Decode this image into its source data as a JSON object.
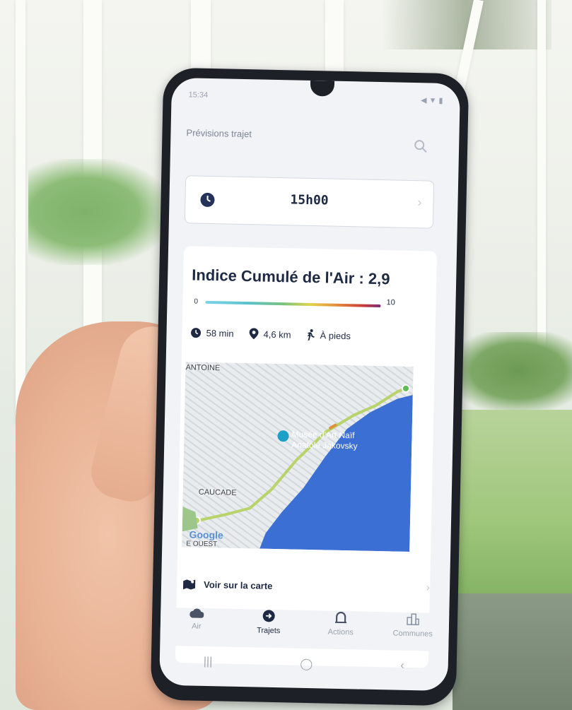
{
  "status_bar": {
    "time": "15:34",
    "right": "◀ ▼ ▮"
  },
  "header": {
    "title": "Prévisions trajet"
  },
  "time_picker": {
    "value": "15h00"
  },
  "air_index": {
    "title": "Indice Cumulé de l'Air : 2,9",
    "scale_min": "0",
    "scale_max": "10"
  },
  "stats": {
    "duration": "58 min",
    "distance": "4,6 km",
    "mode": "À pieds"
  },
  "map": {
    "label_top": "ANTOINE",
    "poi_line1": "Musée d'Art Naïf",
    "poi_line2": "Anatole Jakovsky",
    "label_bottom": "CAUCADE",
    "label_corner": "E OUEST",
    "logo": "Google"
  },
  "see_map": {
    "label": "Voir sur la carte"
  },
  "bottom_nav": [
    {
      "label": "Air",
      "icon": "cloud-icon"
    },
    {
      "label": "Trajets",
      "icon": "arrow-circle-icon"
    },
    {
      "label": "Actions",
      "icon": "arch-icon"
    },
    {
      "label": "Communes",
      "icon": "buildings-icon"
    }
  ],
  "colors": {
    "accent": "#1e2a44",
    "sea": "#3b6fd4",
    "route": "#b8d36a"
  }
}
